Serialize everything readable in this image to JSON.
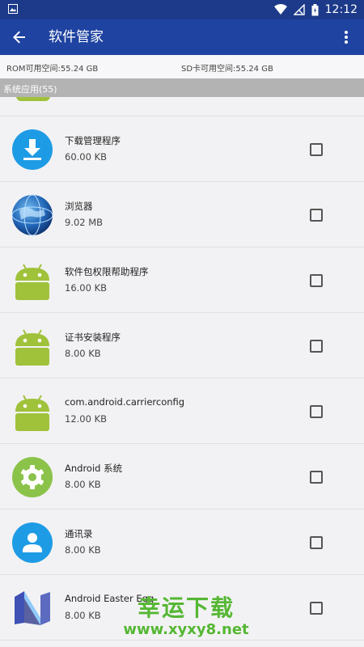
{
  "status_bar": {
    "time": "12:12",
    "icons": [
      "image-icon",
      "wifi-icon",
      "no-signal-icon",
      "battery-icon"
    ]
  },
  "app_bar": {
    "title": "软件管家",
    "back_icon": "arrow-left-icon",
    "more_icon": "more-vert-icon",
    "background": "#1f43a1"
  },
  "storage": {
    "rom": "ROM可用空间:55.24 GB",
    "sd": "SD卡可用空间:55.24 GB"
  },
  "section": {
    "title": "系统应用(55)"
  },
  "apps": [
    {
      "name": "下载管理程序",
      "size": "60.00 KB",
      "icon": "download-icon",
      "checked": false
    },
    {
      "name": "浏览器",
      "size": "9.02 MB",
      "icon": "globe-icon",
      "checked": false
    },
    {
      "name": "软件包权限帮助程序",
      "size": "16.00 KB",
      "icon": "android-icon",
      "checked": false
    },
    {
      "name": "证书安装程序",
      "size": "8.00 KB",
      "icon": "android-icon",
      "checked": false
    },
    {
      "name": "com.android.carrierconfig",
      "size": "12.00 KB",
      "icon": "android-icon",
      "checked": false
    },
    {
      "name": "Android 系统",
      "size": "8.00 KB",
      "icon": "settings-gear-icon",
      "checked": false
    },
    {
      "name": "通讯录",
      "size": "8.00 KB",
      "icon": "contacts-icon",
      "checked": false
    },
    {
      "name": "Android Easter Egg",
      "size": "8.00 KB",
      "icon": "nougat-icon",
      "checked": false
    }
  ],
  "watermark": {
    "line1": "幸运下载",
    "line2": "www.xyxy8.net"
  }
}
